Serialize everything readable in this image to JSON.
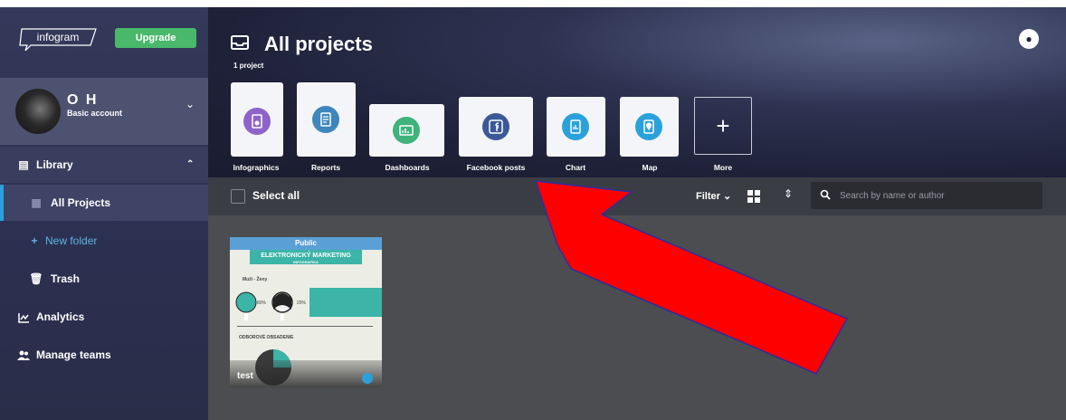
{
  "sidebar": {
    "logo_text": "infogram",
    "upgrade_label": "Upgrade",
    "profile": {
      "name": "O H",
      "plan": "Basic account"
    },
    "library_label": "Library",
    "all_projects_label": "All Projects",
    "new_folder_label": "New folder",
    "trash_label": "Trash",
    "analytics_label": "Analytics",
    "manage_teams_label": "Manage teams"
  },
  "header": {
    "title": "All projects",
    "count": "1 project",
    "types": [
      {
        "label": "Infographics",
        "color": "#8e63c9"
      },
      {
        "label": "Reports",
        "color": "#3f86bd"
      },
      {
        "label": "Dashboards",
        "color": "#3fb37b"
      },
      {
        "label": "Facebook posts",
        "color": "#3b5998"
      },
      {
        "label": "Chart",
        "color": "#2aa1da"
      },
      {
        "label": "Map",
        "color": "#2aa1da"
      },
      {
        "label": "More"
      }
    ]
  },
  "toolbar": {
    "select_all_label": "Select all",
    "filter_label": "Filter",
    "search_placeholder": "Search by name or author"
  },
  "projects": [
    {
      "name": "test",
      "badge": "Public",
      "thumb_title": "ELEKTRONICKÝ MARKETING",
      "thumb_subtitle": "INFOGRAFIKA",
      "thumb_gender_label": "Muži - Ženy",
      "thumb_pct_left": "80%",
      "thumb_pct_right": "20%",
      "thumb_heading": "ODBOROVÉ OBSADENIE"
    }
  ],
  "colors": {
    "accent": "#2aa1da",
    "upgrade": "#49b86b",
    "annotation_arrow": "#ff0000"
  }
}
